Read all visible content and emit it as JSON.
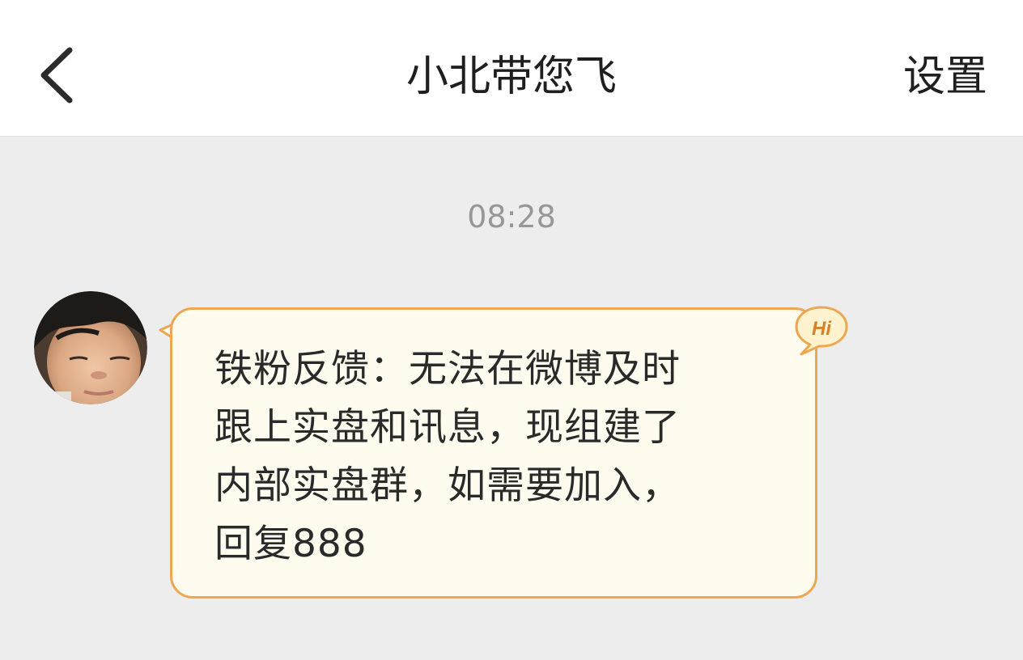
{
  "header": {
    "back_icon": "chevron-left-icon",
    "title": "小北带您飞",
    "settings_label": "设置"
  },
  "conversation": {
    "timestamp": "08:28",
    "messages": [
      {
        "avatar": "child-photo-avatar",
        "badge_text": "Hi",
        "text": "铁粉反馈：无法在微博及时\n跟上实盘和讯息，现组建了\n内部实盘群，如需要加入，\n回复888"
      }
    ]
  },
  "colors": {
    "header_bg": "#ffffff",
    "chat_bg": "#ededed",
    "bubble_bg": "#fffbee",
    "bubble_border": "#eda750",
    "timestamp": "#979797"
  }
}
